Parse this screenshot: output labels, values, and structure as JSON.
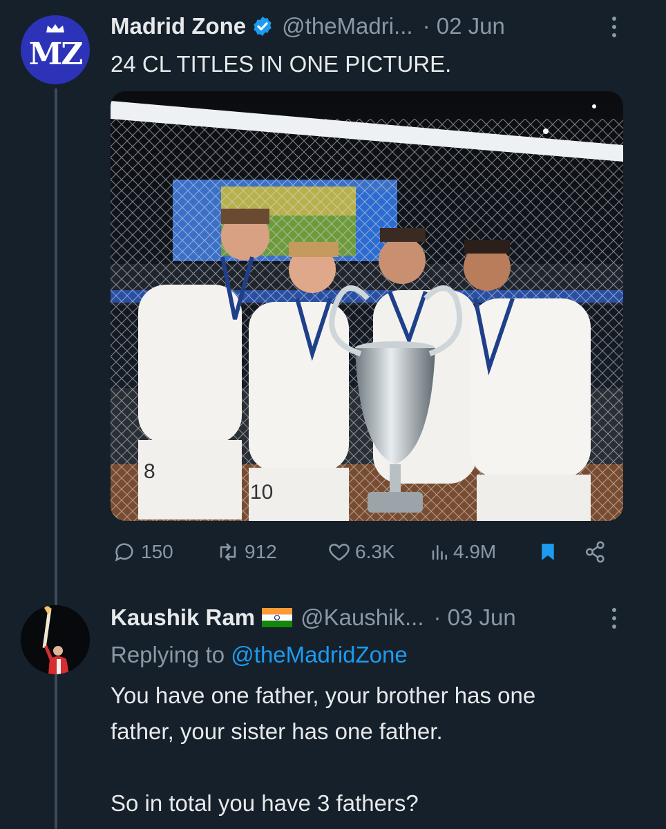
{
  "tweet": {
    "author_name": "Madrid Zone",
    "author_handle": "@theMadri...",
    "date": "· 02 Jun",
    "avatar_text": "MZ",
    "text": "24 CL TITLES IN ONE PICTURE.",
    "stats": {
      "replies": "150",
      "retweets": "912",
      "likes": "6.3K",
      "views": "4.9M"
    }
  },
  "reply": {
    "author_name": "Kaushik Ram",
    "author_handle": "@Kaushik...",
    "date": "· 03 Jun",
    "replying_prefix": "Replying to",
    "replying_to": "@theMadridZone",
    "text_line1": "You have one father, your brother has one",
    "text_line2": "father, your sister has one father.",
    "text_line3": "So in total you have 3 fathers?"
  },
  "media_numbers": {
    "shirt_a": "8",
    "shirt_b": "10"
  },
  "colors": {
    "background": "#15202b",
    "accent": "#1d9bf0",
    "muted": "#8b98a5",
    "brand_blue": "#2c33b8"
  }
}
